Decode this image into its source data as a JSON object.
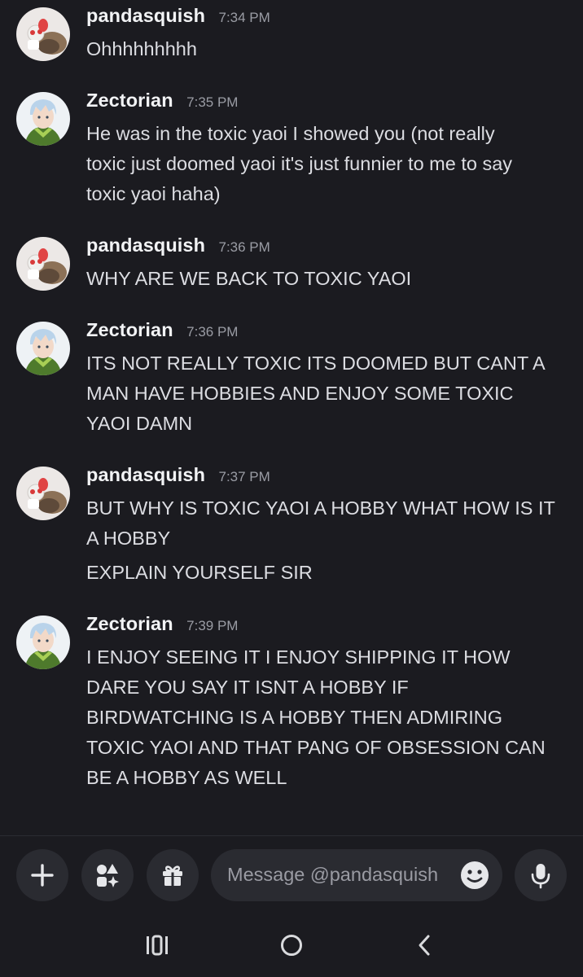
{
  "recipient": "@pandasquish",
  "messages": [
    {
      "author": "pandasquish",
      "time": "7:34 PM",
      "avatar": "panda-avatar",
      "lines": [
        "Ohhhhhhhhh"
      ]
    },
    {
      "author": "Zectorian",
      "time": "7:35 PM",
      "avatar": "zectorian-avatar",
      "lines": [
        "He was in the toxic yaoi I showed you (not really",
        "toxic just doomed yaoi it's just funnier to me to say",
        "toxic yaoi haha)"
      ]
    },
    {
      "author": "pandasquish",
      "time": "7:36 PM",
      "avatar": "panda-avatar",
      "lines": [
        "WHY ARE WE BACK TO TOXIC YAOI"
      ]
    },
    {
      "author": "Zectorian",
      "time": "7:36 PM",
      "avatar": "zectorian-avatar",
      "lines": [
        "ITS NOT REALLY TOXIC ITS DOOMED BUT CANT A",
        "MAN HAVE HOBBIES AND ENJOY SOME TOXIC",
        "YAOI DAMN"
      ]
    },
    {
      "author": "pandasquish",
      "time": "7:37 PM",
      "avatar": "panda-avatar",
      "lines": [
        "BUT WHY IS TOXIC YAOI A HOBBY WHAT HOW IS IT",
        "A HOBBY"
      ],
      "followup": "EXPLAIN YOURSELF SIR"
    },
    {
      "author": "Zectorian",
      "time": "7:39 PM",
      "avatar": "zectorian-avatar",
      "lines": [
        "I ENJOY SEEING IT I ENJOY SHIPPING IT HOW",
        "DARE YOU SAY IT ISNT A HOBBY IF",
        "BIRDWATCHING IS A HOBBY THEN ADMIRING",
        "TOXIC YAOI AND THAT PANG OF OBSESSION CAN",
        "BE A HOBBY AS WELL"
      ]
    }
  ],
  "composer": {
    "placeholder": "Message @pandasquish",
    "buttons": [
      "plus-icon",
      "apps-icon",
      "gift-icon",
      "emoji-icon",
      "microphone-icon"
    ]
  },
  "system_nav": [
    "recent-apps-icon",
    "home-icon",
    "back-icon"
  ],
  "colors": {
    "background": "#1b1b20",
    "input_background": "#2a2b31",
    "username": "#f2f3f5",
    "message_text": "#dcdde2",
    "timestamp": "#9a9ca4"
  }
}
